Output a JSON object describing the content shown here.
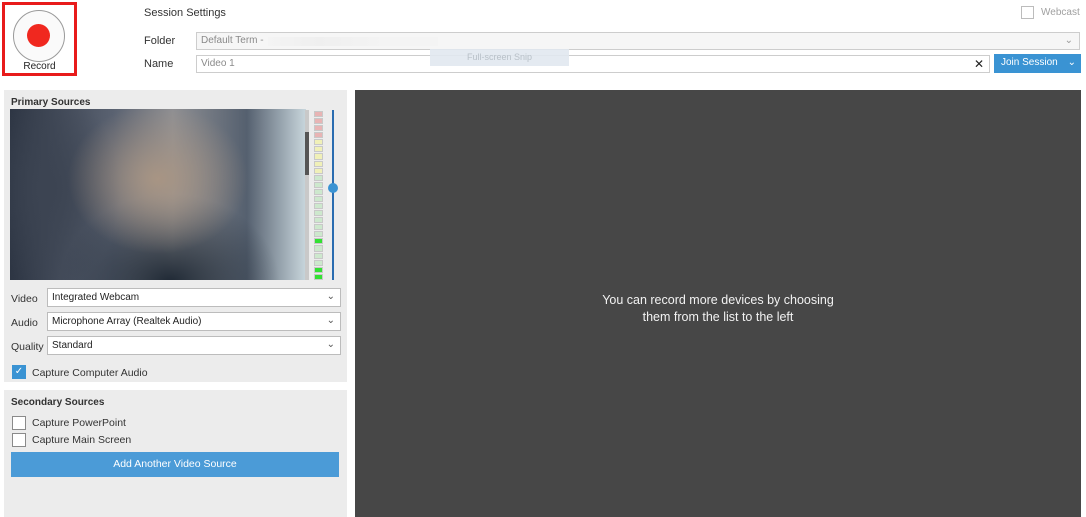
{
  "record": {
    "label": "Record"
  },
  "session": {
    "title": "Session Settings",
    "folder_label": "Folder",
    "folder_value": "Default Term -",
    "name_label": "Name",
    "name_value": "Video 1",
    "webcast_label": "Webcast",
    "webcast_checked": false,
    "join_label": "Join Session",
    "snip_overlay": "Full-screen Snip"
  },
  "primary": {
    "title": "Primary Sources",
    "audio_level_fraction": 0.15,
    "meter_levels": [
      "#e8b4b4",
      "#e8b4b4",
      "#e8b4b4",
      "#e8b4b4",
      "#f0f0b8",
      "#f0f0b8",
      "#f0f0b8",
      "#f0f0b8",
      "#f0f0b8",
      "#cde8cd",
      "#cde8cd",
      "#cde8cd",
      "#cde8cd",
      "#cde8cd",
      "#cde8cd",
      "#cde8cd",
      "#cde8cd",
      "#cde8cd",
      "#33e033",
      "#cde8cd",
      "#cde8cd",
      "#cde8cd",
      "#33e033",
      "#33e033"
    ],
    "video": {
      "label": "Video",
      "value": "Integrated Webcam"
    },
    "audio": {
      "label": "Audio",
      "value": "Microphone Array (Realtek Audio)"
    },
    "quality": {
      "label": "Quality",
      "value": "Standard"
    },
    "capture_audio": {
      "label": "Capture Computer Audio",
      "checked": true
    }
  },
  "secondary": {
    "title": "Secondary Sources",
    "powerpoint": {
      "label": "Capture PowerPoint",
      "checked": false
    },
    "main_screen": {
      "label": "Capture Main Screen",
      "checked": false
    },
    "add_label": "Add Another Video Source"
  },
  "canvas": {
    "message_line1": "You can record more devices by choosing",
    "message_line2": "them from the list to the left"
  },
  "colors": {
    "accent": "#3a93d3",
    "record_red": "#f0281f",
    "highlight_border": "#e81b1b",
    "canvas_bg": "#474747"
  },
  "icons": {
    "record": "record-dot-icon",
    "chevron": "chevron-down-icon",
    "clear": "close-icon",
    "check": "checkmark-icon"
  }
}
